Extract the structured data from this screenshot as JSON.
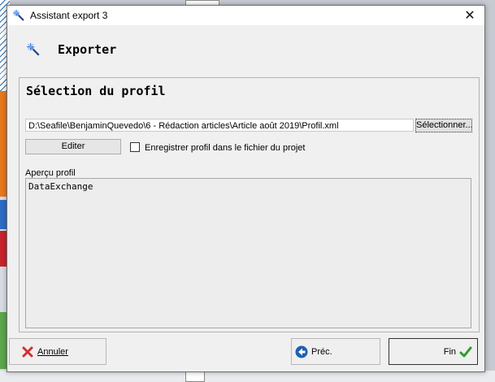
{
  "window": {
    "title": "Assistant export 3",
    "close_glyph": "✕"
  },
  "header": {
    "title": "Exporter",
    "icon": "magic-wand-icon"
  },
  "profile_section": {
    "title": "Sélection du profil",
    "path_value": "D:\\Seafile\\BenjaminQuevedo\\6 - Rédaction articles\\Article août 2019\\Profil.xml",
    "select_label": "Sélectionner...",
    "edit_label": "Editer",
    "save_checkbox_label": "Enregistrer profil dans le fichier du projet",
    "save_checkbox_checked": false,
    "preview_label": "Aperçu profil",
    "preview_text": "DataExchange"
  },
  "footer": {
    "cancel_label": "Annuler",
    "prev_label": "Préc.",
    "finish_label": "Fin"
  },
  "colors": {
    "cancel_icon": "#d32f2f",
    "prev_icon": "#1e5fb4",
    "finish_icon": "#2e9b2e",
    "dialog_bg": "#f0f0f0"
  }
}
